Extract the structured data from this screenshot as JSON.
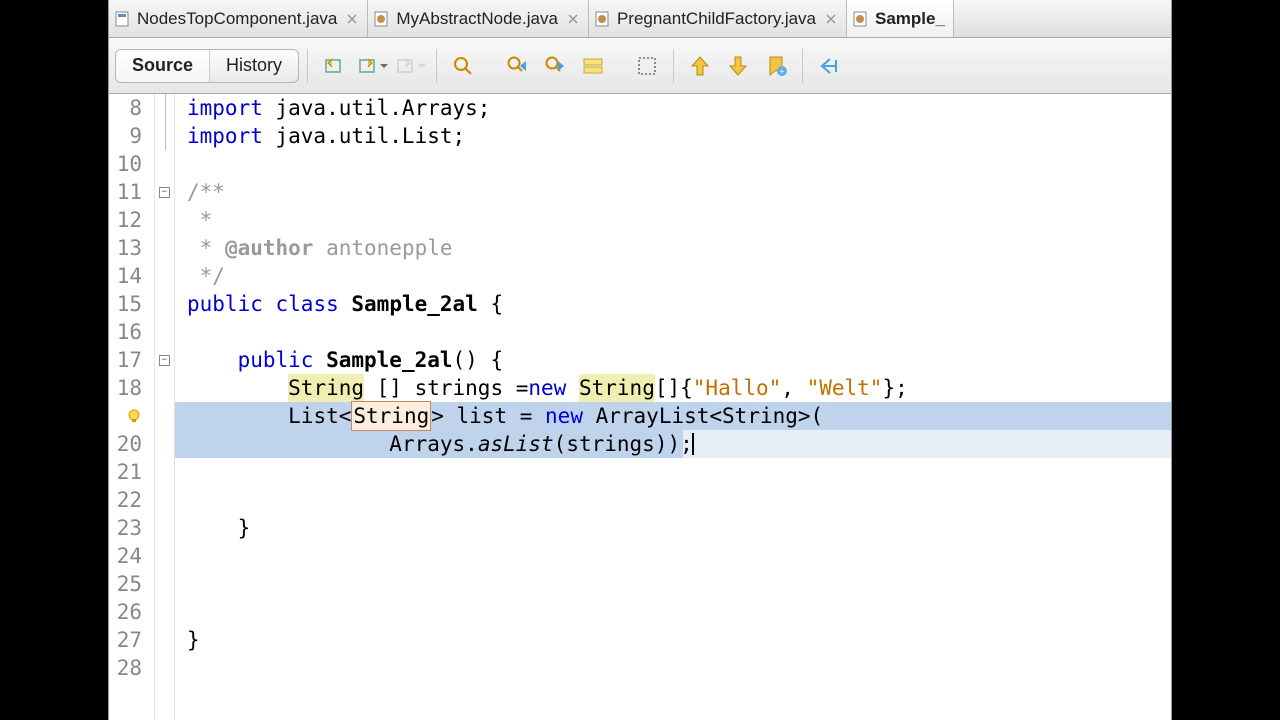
{
  "tabs": [
    {
      "label": "NodesTopComponent.java",
      "active": false,
      "iconColor": "#5b8ec9"
    },
    {
      "label": "MyAbstractNode.java",
      "active": false,
      "iconColor": "#c98b4a"
    },
    {
      "label": "PregnantChildFactory.java",
      "active": false,
      "iconColor": "#c98b4a"
    },
    {
      "label": "Sample_",
      "active": true,
      "iconColor": "#c98b4a"
    }
  ],
  "viewTabs": {
    "source": "Source",
    "history": "History"
  },
  "gutter": {
    "start": 8,
    "end": 28
  },
  "code": {
    "l8": {
      "kw": "import",
      "rest": " java.util.Arrays;"
    },
    "l9": {
      "kw": "import",
      "rest": " java.util.List;"
    },
    "l10": {
      "text": ""
    },
    "l11": {
      "text": "/**"
    },
    "l12": {
      "text": " *"
    },
    "l13": {
      "pre": " * ",
      "ann": "@author",
      "rest": " antonepple"
    },
    "l14": {
      "text": " */"
    },
    "l15": {
      "kw1": "public",
      "kw2": "class",
      "name": "Sample_2al",
      "rest": " {"
    },
    "l16": {
      "text": ""
    },
    "l17": {
      "kw": "public",
      "name": "Sample_2al",
      "rest": "() {"
    },
    "l18": {
      "type1": "String",
      "mid": " [] strings =",
      "kw": "new",
      "type2": "String",
      "arr": "[]{",
      "s1": "\"Hallo\"",
      "comma": ", ",
      "s2": "\"Welt\"",
      "end": "};"
    },
    "l19": {
      "pre": "List<",
      "boxed": "String",
      "mid1": "> list = ",
      "kw": "new",
      "mid2": " ArrayList<String>("
    },
    "l20": {
      "pre": "Arrays.",
      "it": "asList",
      "rest": "(strings));"
    },
    "l21": {
      "text": ""
    },
    "l22": {
      "text": ""
    },
    "l23": {
      "text": "    }"
    },
    "l24": {
      "text": ""
    },
    "l25": {
      "text": ""
    },
    "l26": {
      "text": ""
    },
    "l27": {
      "text": "}"
    },
    "l28": {
      "text": ""
    }
  }
}
